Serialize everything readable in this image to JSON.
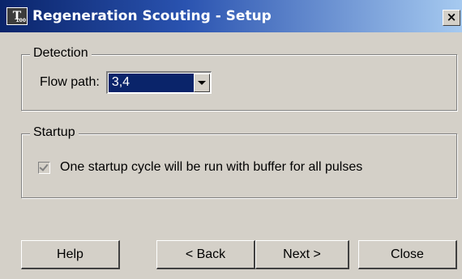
{
  "window": {
    "title": "Regeneration Scouting - Setup",
    "icon_letter": "T",
    "icon_sub": "100",
    "close_glyph": "×"
  },
  "detection": {
    "group_label": "Detection",
    "flow_path_label": "Flow path:",
    "flow_path_value": "3,4"
  },
  "startup": {
    "group_label": "Startup",
    "checkbox_label": "One startup cycle will be run with buffer for all pulses",
    "checkbox_checked": true,
    "checkbox_enabled": false
  },
  "buttons": {
    "help": "Help",
    "back": "< Back",
    "next": "Next >",
    "close": "Close"
  }
}
